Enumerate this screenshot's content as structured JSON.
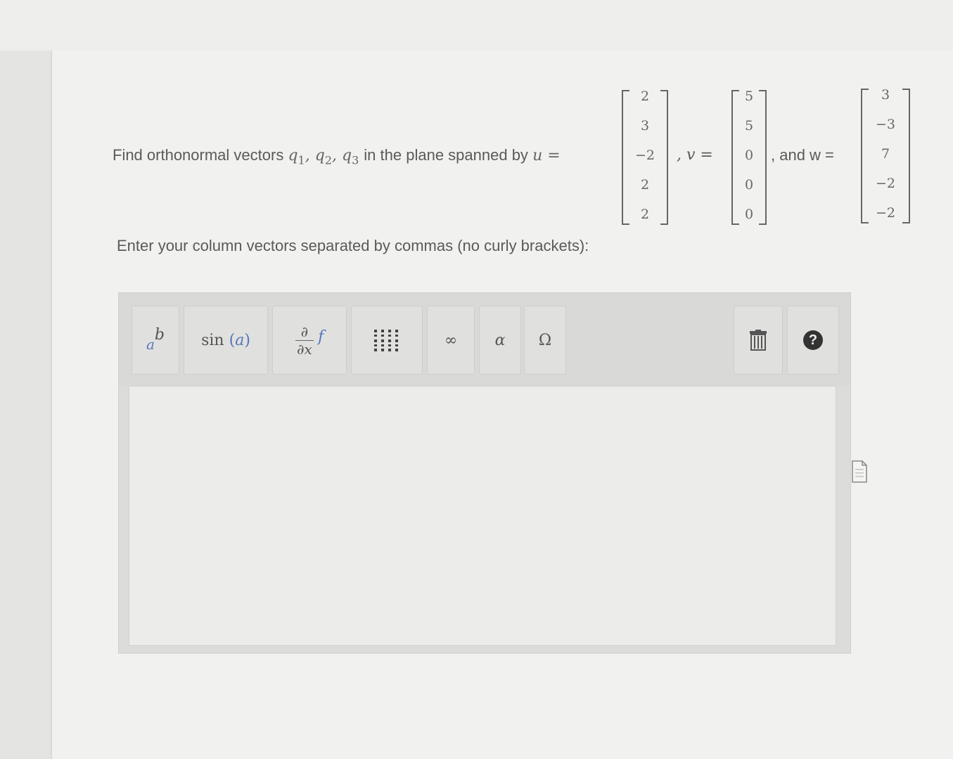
{
  "question": {
    "prefix": "Find orthonormal vectors",
    "vectors": [
      "q",
      "q",
      "q"
    ],
    "subs": [
      "1",
      "2",
      "3"
    ],
    "middle": "in the plane spanned by",
    "u_label": "u =",
    "v_label": ", v =",
    "w_label": ", and w ="
  },
  "vector_u": [
    "2",
    "3",
    "−2",
    "2",
    "2"
  ],
  "vector_v": [
    "5",
    "5",
    "0",
    "0",
    "0"
  ],
  "vector_w": [
    "3",
    "−3",
    "7",
    "−2",
    "−2"
  ],
  "instructions": "Enter your column vectors separated by commas (no curly brackets):",
  "toolbar": {
    "superscript_base": "a",
    "superscript_exp": "b",
    "trig": "sin",
    "trig_arg": "a",
    "deriv_num": "∂",
    "deriv_den": "∂x",
    "deriv_f": "f",
    "infinity": "∞",
    "alpha": "α",
    "omega": "Ω",
    "help": "?"
  },
  "answer_value": "",
  "icons": [
    "matrix-icon",
    "trash-icon",
    "help-icon",
    "document-icon"
  ]
}
